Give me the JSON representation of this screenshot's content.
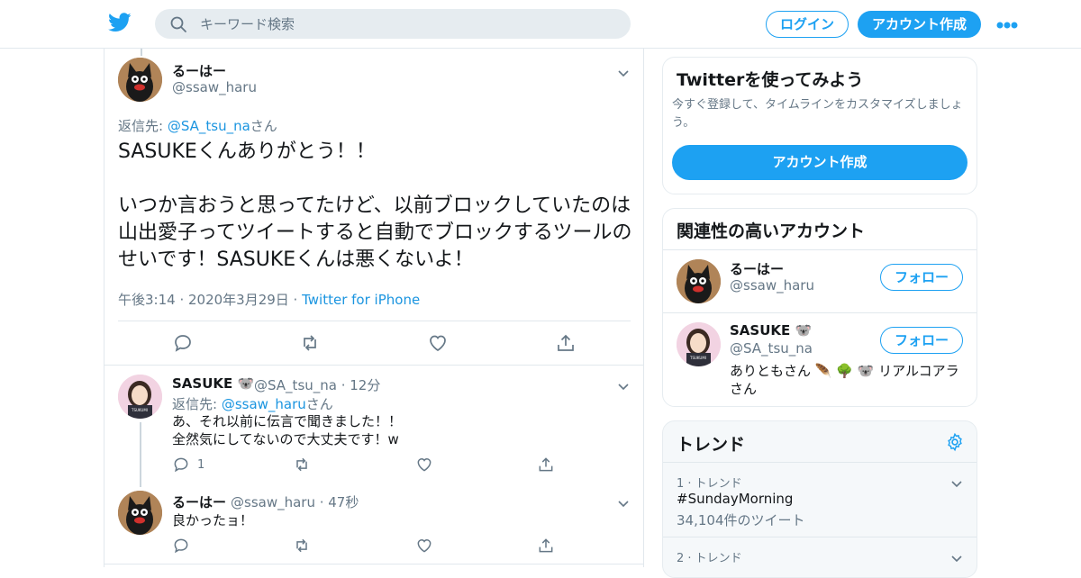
{
  "colors": {
    "accent": "#1da1f2",
    "link": "#1b95e0",
    "text": "#14171a",
    "muted": "#657786"
  },
  "header": {
    "logo_icon": "twitter-bird-icon",
    "search_placeholder": "キーワード検索",
    "login_label": "ログイン",
    "signup_label": "アカウント作成",
    "more_icon": "more-dots-icon"
  },
  "tweet": {
    "name": "るーはー",
    "handle": "@ssaw_haru",
    "reply_prefix": "返信先: ",
    "reply_handle": "@SA_tsu_na",
    "reply_suffix": "さん",
    "text": "SASUKEくんありがとう！！\n\nいつか言おうと思ってたけど、以前ブロックしていたのは山出愛子ってツイートすると自動でブロックするツールのせいです！SASUKEくんは悪くないよ！",
    "time": "午後3:14 · 2020年3月29日 · ",
    "source": "Twitter for iPhone"
  },
  "replies": [
    {
      "name": "SASUKE 🐨",
      "handle": "@SA_tsu_na · 12分",
      "reply_prefix": "返信先: ",
      "reply_handle": "@ssaw_haru",
      "reply_suffix": "さん",
      "text": "あ、それ以前に伝言で聞きました！！\n全然気にしてないので大丈夫です！w",
      "reply_count": "1"
    },
    {
      "name": "るーはー",
      "handle": "@ssaw_haru · 47秒",
      "text": "良かったョ！"
    }
  ],
  "signup_card": {
    "title": "Twitterを使ってみよう",
    "subtitle": "今すぐ登録して、タイムラインをカスタマイズしましょう。",
    "button": "アカウント作成"
  },
  "related": {
    "title": "関連性の高いアカウント",
    "follow_label": "フォロー",
    "accounts": [
      {
        "name": "るーはー",
        "handle": "@ssaw_haru",
        "bio": ""
      },
      {
        "name": "SASUKE 🐨",
        "handle": "@SA_tsu_na",
        "bio": "ありともさん 🪶 🌳 🐨 リアルコアラさん"
      }
    ]
  },
  "trends": {
    "title": "トレンド",
    "items": [
      {
        "meta": "1 · トレンド",
        "name": "#SundayMorning",
        "count": "34,104件のツイート"
      },
      {
        "meta": "2 · トレンド",
        "name": "",
        "count": ""
      }
    ]
  }
}
